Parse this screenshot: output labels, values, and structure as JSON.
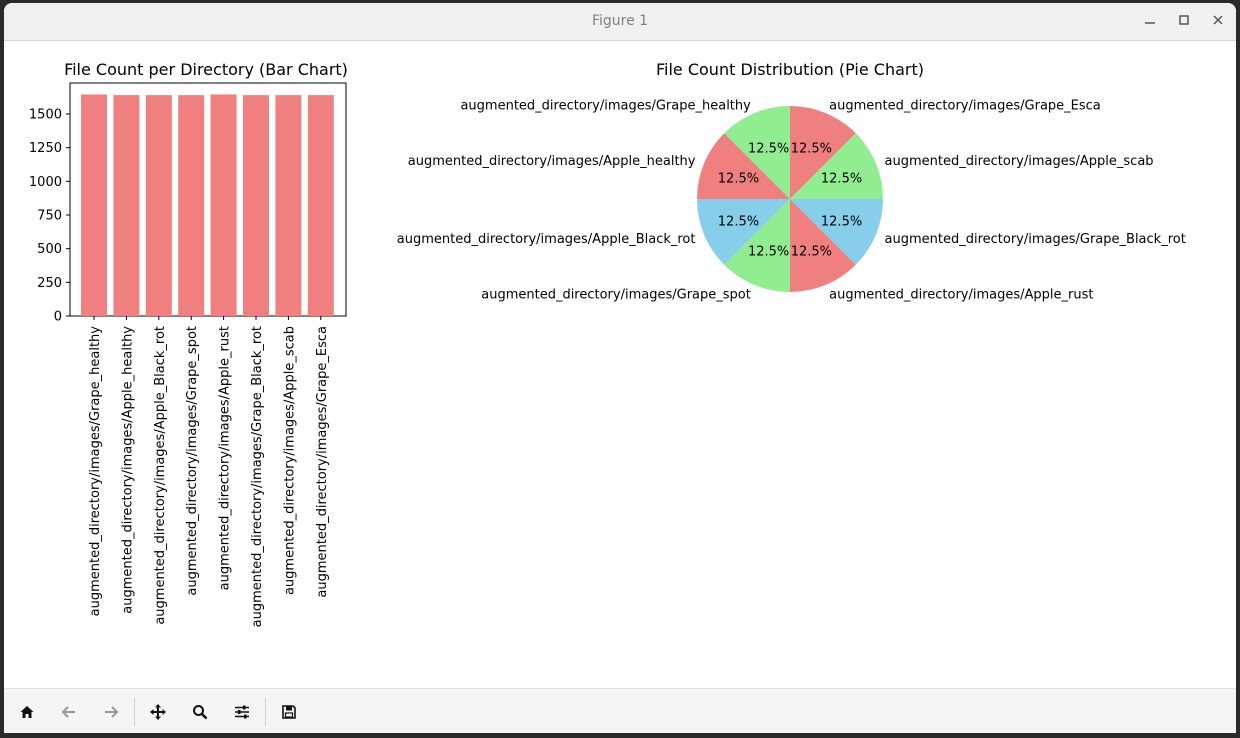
{
  "window": {
    "title": "Figure 1",
    "controls": {
      "minimize": "minimize-icon",
      "maximize": "maximize-icon",
      "close": "close-icon"
    }
  },
  "toolbar": {
    "buttons": [
      {
        "name": "home-button",
        "icon": "home-icon"
      },
      {
        "name": "back-button",
        "icon": "arrow-left-icon"
      },
      {
        "name": "forward-button",
        "icon": "arrow-right-icon"
      },
      {
        "name": "pan-button",
        "icon": "move-icon"
      },
      {
        "name": "zoom-button",
        "icon": "zoom-icon"
      },
      {
        "name": "configure-subplots-button",
        "icon": "sliders-icon"
      },
      {
        "name": "save-button",
        "icon": "save-icon"
      }
    ]
  },
  "chart_data": [
    {
      "type": "bar",
      "title": "File Count per Directory (Bar Chart)",
      "categories": [
        "augmented_directory/images/Grape_healthy",
        "augmented_directory/images/Apple_healthy",
        "augmented_directory/images/Apple_Black_rot",
        "augmented_directory/images/Grape_spot",
        "augmented_directory/images/Apple_rust",
        "augmented_directory/images/Grape_Black_rot",
        "augmented_directory/images/Apple_scab",
        "augmented_directory/images/Grape_Esca"
      ],
      "values": [
        1645,
        1640,
        1640,
        1640,
        1645,
        1640,
        1640,
        1640
      ],
      "ylim": [
        0,
        1730
      ],
      "yticks": [
        0,
        250,
        500,
        750,
        1000,
        1250,
        1500
      ],
      "color": "#f08080",
      "xlabel": "",
      "ylabel": ""
    },
    {
      "type": "pie",
      "title": "File Count Distribution (Pie Chart)",
      "slices": [
        {
          "label": "augmented_directory/images/Grape_Esca",
          "value": 12.5,
          "pct": "12.5%",
          "color": "#f08080"
        },
        {
          "label": "augmented_directory/images/Apple_scab",
          "value": 12.5,
          "pct": "12.5%",
          "color": "#90ee90"
        },
        {
          "label": "augmented_directory/images/Grape_Black_rot",
          "value": 12.5,
          "pct": "12.5%",
          "color": "#87ceeb"
        },
        {
          "label": "augmented_directory/images/Apple_rust",
          "value": 12.5,
          "pct": "12.5%",
          "color": "#f08080"
        },
        {
          "label": "augmented_directory/images/Grape_spot",
          "value": 12.5,
          "pct": "12.5%",
          "color": "#90ee90"
        },
        {
          "label": "augmented_directory/images/Apple_Black_rot",
          "value": 12.5,
          "pct": "12.5%",
          "color": "#87ceeb"
        },
        {
          "label": "augmented_directory/images/Apple_healthy",
          "value": 12.5,
          "pct": "12.5%",
          "color": "#f08080"
        },
        {
          "label": "augmented_directory/images/Grape_healthy",
          "value": 12.5,
          "pct": "12.5%",
          "color": "#90ee90"
        }
      ]
    }
  ]
}
